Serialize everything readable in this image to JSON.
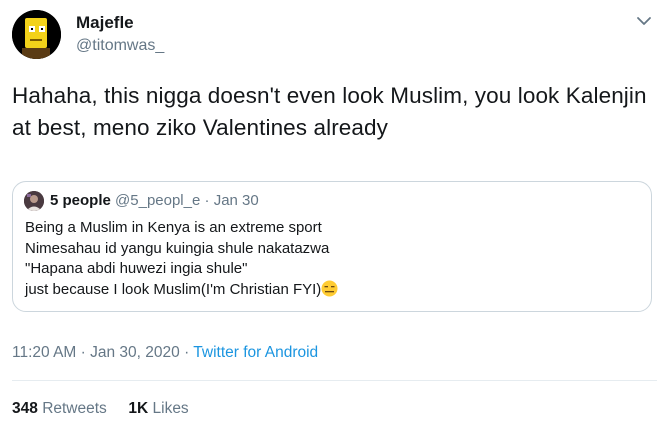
{
  "author": {
    "display_name": "Majefle",
    "handle": "@titomwas_",
    "avatar_icon": "cartoon-character-avatar"
  },
  "tweet": {
    "text": "Hahaha, this nigga doesn't even look Muslim, you look Kalenjin at best, meno ziko Valentines already"
  },
  "quoted": {
    "display_name": "5 people",
    "handle": "@5_peopl_e",
    "separator": " · ",
    "date": "Jan 30",
    "lines": [
      "Being a Muslim in Kenya is an extreme sport",
      "Nimesahau id yangu kuingia shule nakatazwa",
      "\"Hapana abdi huwezi ingia shule\"",
      "just because I look Muslim(I'm Christian FYI)"
    ],
    "emoji_icon": "expressionless-face-emoji"
  },
  "meta": {
    "time": "11:20 AM",
    "sep1": " · ",
    "date": "Jan 30, 2020",
    "sep2": " · ",
    "source": "Twitter for Android"
  },
  "stats": {
    "retweets_count": "348",
    "retweets_label": "Retweets",
    "likes_count": "1K",
    "likes_label": "Likes"
  },
  "colors": {
    "text": "#14171a",
    "secondary": "#657786",
    "link": "#1b95e0",
    "border": "#ccd6dd"
  }
}
